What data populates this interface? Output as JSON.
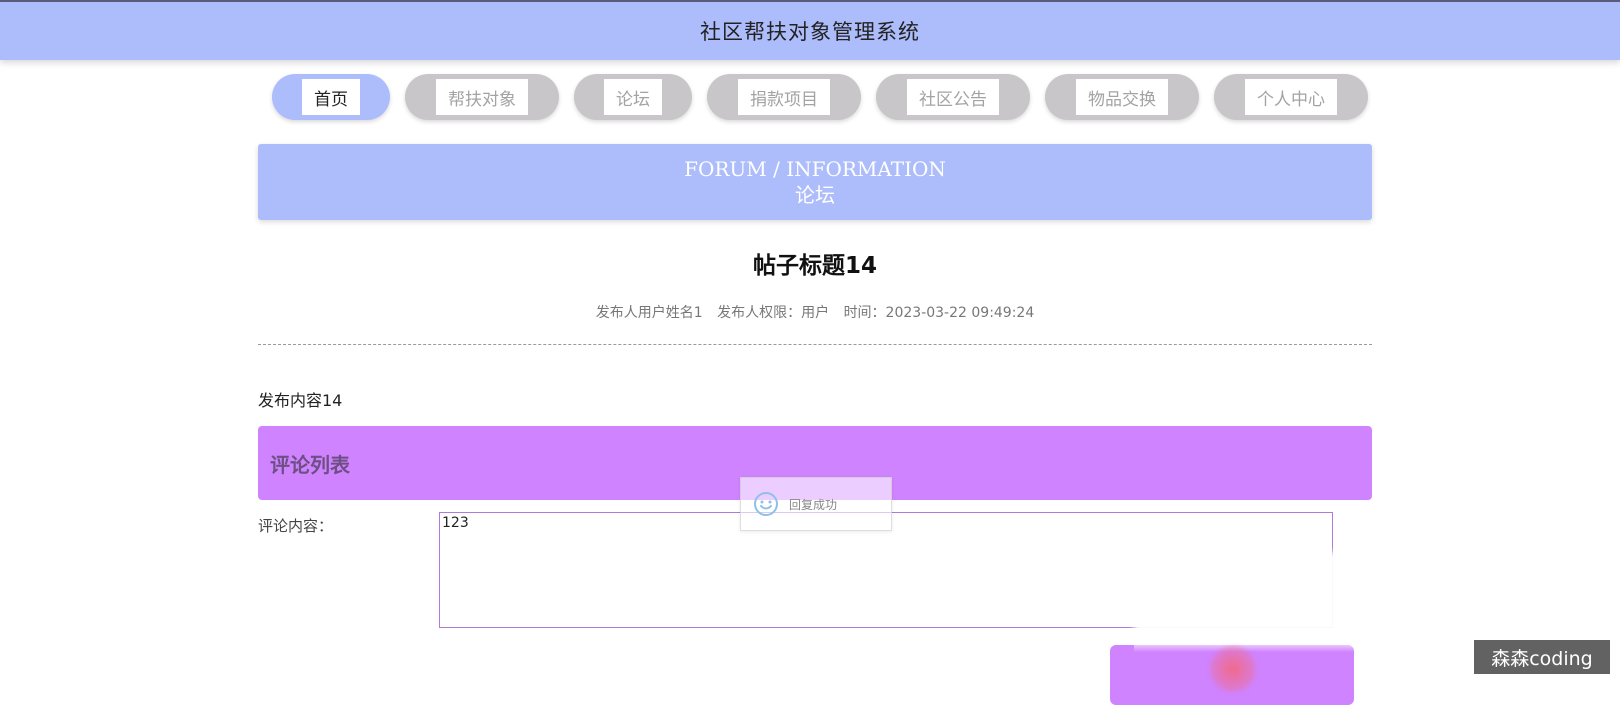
{
  "header": {
    "title": "社区帮扶对象管理系统"
  },
  "nav": {
    "items": [
      {
        "label": "首页",
        "active": true
      },
      {
        "label": "帮扶对象",
        "active": false
      },
      {
        "label": "论坛",
        "active": false
      },
      {
        "label": "捐款项目",
        "active": false
      },
      {
        "label": "社区公告",
        "active": false
      },
      {
        "label": "物品交换",
        "active": false
      },
      {
        "label": "个人中心",
        "active": false
      }
    ]
  },
  "banner": {
    "en": "FORUM / INFORMATION",
    "cn": "论坛"
  },
  "post": {
    "title": "帖子标题14",
    "author": "发布人用户姓名1",
    "role": "发布人权限：用户",
    "time": "时间：2023-03-22 09:49:24",
    "content": "发布内容14"
  },
  "comments": {
    "header": "评论列表",
    "label": "评论内容：",
    "value": "123"
  },
  "toast": {
    "text": "回复成功"
  },
  "watermark": "森森coding",
  "colors": {
    "header_bg": "#adbcfb",
    "nav_inactive": "#c8c6c8",
    "comment_header_bg": "#d083fe",
    "textarea_border": "#b07ad8"
  }
}
